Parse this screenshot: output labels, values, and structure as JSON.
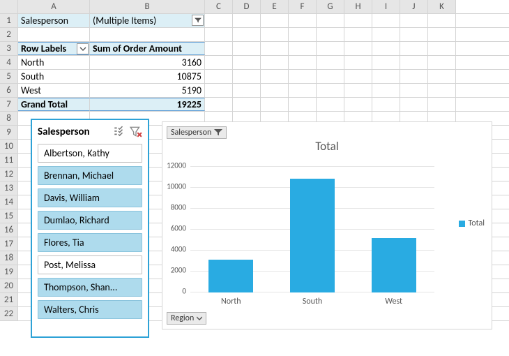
{
  "columns": [
    "A",
    "B",
    "C",
    "D",
    "E",
    "F",
    "G",
    "H",
    "I",
    "J",
    "K"
  ],
  "pivot": {
    "filter_field": "Salesperson",
    "filter_value": "(Multiple Items)",
    "row_header": "Row Labels",
    "value_header": "Sum of Order Amount",
    "rows": [
      {
        "label": "North",
        "value": "3160"
      },
      {
        "label": "South",
        "value": "10875"
      },
      {
        "label": "West",
        "value": "5190"
      }
    ],
    "grand_label": "Grand Total",
    "grand_value": "19225"
  },
  "slicer": {
    "title": "Salesperson",
    "items": [
      {
        "label": "Albertson, Kathy",
        "selected": false
      },
      {
        "label": "Brennan, Michael",
        "selected": true
      },
      {
        "label": "Davis, William",
        "selected": true
      },
      {
        "label": "Dumlao, Richard",
        "selected": true
      },
      {
        "label": "Flores, Tia",
        "selected": true
      },
      {
        "label": "Post, Melissa",
        "selected": false
      },
      {
        "label": "Thompson, Shan...",
        "selected": true
      },
      {
        "label": "Walters, Chris",
        "selected": true
      }
    ]
  },
  "chart_data": {
    "type": "bar",
    "title": "Total",
    "categories": [
      "North",
      "South",
      "West"
    ],
    "values": [
      3160,
      10875,
      5190
    ],
    "series_name": "Total",
    "ylim": [
      0,
      12000
    ],
    "ytick_step": 2000,
    "filter_field": "Salesperson",
    "axis_field": "Region"
  }
}
